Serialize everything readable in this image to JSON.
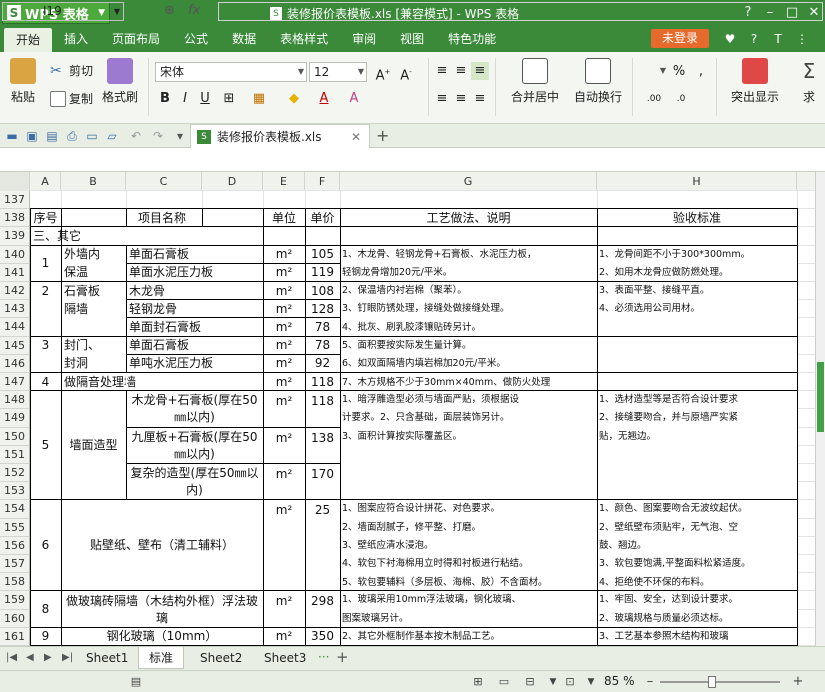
{
  "app": {
    "name": "WPS 表格",
    "logo_letter": "S",
    "window_title": "装修报价表模板.xls [兼容模式] - WPS 表格"
  },
  "menu": {
    "tabs": [
      "开始",
      "插入",
      "页面布局",
      "公式",
      "数据",
      "表格样式",
      "审阅",
      "视图",
      "特色功能"
    ],
    "login": "未登录"
  },
  "ribbon": {
    "paste": "粘贴",
    "cut": "剪切",
    "copy": "复制",
    "format_painter": "格式刷",
    "font_name": "宋体",
    "font_size": "12",
    "merge_center": "合并居中",
    "auto_wrap": "自动换行",
    "highlight_show": "突出显示",
    "sum_cut": "求",
    "percent": "%",
    "comma": ","
  },
  "doc_tab": "装修报价表模板.xls",
  "formula_bar": {
    "cell_ref": "I19",
    "fx": "fx",
    "value": ""
  },
  "columns": [
    "A",
    "B",
    "C",
    "D",
    "E",
    "F",
    "G",
    "H"
  ],
  "rows": [
    "137",
    "138",
    "139",
    "140",
    "141",
    "142",
    "143",
    "144",
    "145",
    "146",
    "147",
    "148",
    "149",
    "150",
    "151",
    "152",
    "153",
    "154",
    "155",
    "156",
    "157",
    "158",
    "159",
    "160",
    "161"
  ],
  "header": {
    "seq": "序号",
    "item": "项目名称",
    "unit": "单位",
    "price": "单价",
    "process": "工艺做法、说明",
    "accept": "验收标准"
  },
  "section_title": "三、其它",
  "cells": {
    "a140": "1",
    "b140": "外墙内",
    "b141": "保温",
    "c140": "单面石膏板",
    "c141": "单面水泥压力板",
    "e140": "m²",
    "f140": "105",
    "e141": "m²",
    "f141": "119",
    "a142": "2",
    "b142": "石膏板",
    "b143": "隔墙",
    "c142": "木龙骨",
    "c143": "轻钢龙骨",
    "c144": "单面封石膏板",
    "e142": "m²",
    "f142": "108",
    "e143": "m²",
    "f143": "128",
    "e144": "m²",
    "f144": "78",
    "a145": "3",
    "b145": "封门、",
    "b146": "封洞",
    "c145": "单面石膏板",
    "c146": "单吨水泥压力板",
    "e145": "m²",
    "f145": "78",
    "e146": "m²",
    "f146": "92",
    "a147": "4",
    "b147": "做隔音处理墙",
    "e147": "m²",
    "f147": "118",
    "a150": "5",
    "b150": "墙面造型",
    "c148": "木龙骨+石膏板(厚在50㎜以内)",
    "e148": "m²",
    "f148": "118",
    "c150": "九厘板+石膏板(厚在50㎜以内)",
    "e150": "m²",
    "f150": "138",
    "c152": "复杂的造型(厚在50㎜以内)",
    "e152": "m²",
    "f152": "170",
    "a156": "6",
    "b156": "贴壁纸、壁布（清工辅料）",
    "e156": "m²",
    "f156": "25",
    "a159": "8",
    "b159": "做玻璃砖隔墙（木结构外框）浮法玻璃",
    "e159": "m²",
    "f159": "298",
    "a161": "9",
    "b161": "钢化玻璃（10mm）",
    "e161": "m²",
    "f161": "350"
  },
  "process_notes": {
    "g140": "1、木龙骨、轻钢龙骨+石膏板、水泥压力板，\n轻钢龙骨增加20元/平米。\n2、保温墙内衬岩棉（聚苯）。\n3、钉眼防锈处理，接缝处做接缝处理。\n4、批灰、刷乳胶漆镶贴砖另计。\n5、面积要按实际发生量计算。\n6、如双面隔墙内填岩棉加20元/平米。\n7、木方规格不少于30mm×40mm、做防火处理",
    "h140": "1、龙骨间距不小于300*300mm。\n2、如用木龙骨应做防燃处理。\n3、表面平整、接缝平直。\n4、必须选用公司用材。",
    "g148": "1、暗浮雕造型必须与墙面严贴，须根据设\n计要求。2、只含基础，面层装饰另计。\n3、面积计算按实际覆盖区。",
    "h148": "1、选材造型等是否符合设计要求\n2、接缝要吻合，并与原墙严实紧\n贴，无翘边。",
    "g154": "1、图案应符合设计拼花、对色要求。\n2、墙面刮腻子，修平整、打磨。\n3、壁纸应清水浸泡。\n4、软包下衬海棉用立时得和衬板进行粘结。\n5、软包要辅料（多层板、海棉、胶）不含面材。",
    "h154": "1、颜色、图案要吻合无波纹起伏。\n2、壁纸壁布须贴牢，无气泡、空\n鼓、翘边。\n3、软包要饱满,平整面料松紧适度。\n4、拒绝使不环保的布料。",
    "g159": "1、玻璃采用10mm浮法玻璃，钢化玻璃、\n图案玻璃另计。\n2、其它外框制作基本按木制品工艺。",
    "h159": "1、牢固、安全，达到设计要求。\n2、玻璃规格与质量必须达标。\n3、工艺基本参照木结构和玻璃"
  },
  "sheets": [
    "Sheet1",
    "标准",
    "Sheet2",
    "Sheet3"
  ],
  "active_sheet": "标准",
  "status": {
    "zoom": "85 %"
  }
}
